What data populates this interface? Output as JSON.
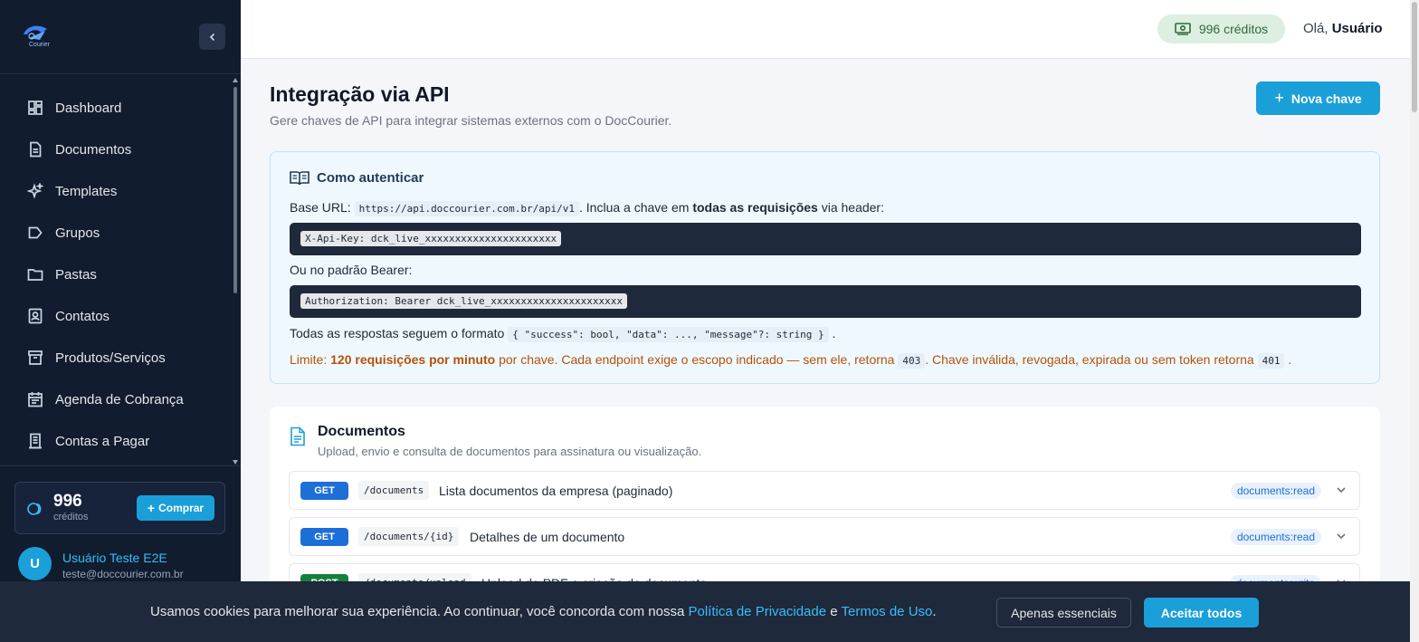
{
  "sidebar": {
    "logo_text": "Courier",
    "items": [
      {
        "label": "Dashboard",
        "icon": "dashboard-icon"
      },
      {
        "label": "Documentos",
        "icon": "document-icon"
      },
      {
        "label": "Templates",
        "icon": "sparkles-icon"
      },
      {
        "label": "Grupos",
        "icon": "tag-icon"
      },
      {
        "label": "Pastas",
        "icon": "folder-icon"
      },
      {
        "label": "Contatos",
        "icon": "contacts-icon"
      },
      {
        "label": "Produtos/Serviços",
        "icon": "archive-icon"
      },
      {
        "label": "Agenda de Cobrança",
        "icon": "calendar-icon"
      },
      {
        "label": "Contas a Pagar",
        "icon": "receipt-icon"
      }
    ],
    "credits": {
      "value": "996",
      "label": "créditos",
      "buy_label": "Comprar"
    },
    "user": {
      "initial": "U",
      "name": "Usuário Teste E2E",
      "email": "teste@doccourier.com.br"
    }
  },
  "header": {
    "credits_label": "996 créditos",
    "greeting_prefix": "Olá,",
    "greeting_name": "Usuário"
  },
  "main": {
    "title": "Integração via API",
    "subtitle": "Gere chaves de API para integrar sistemas externos com o DocCourier.",
    "new_key_label": "Nova chave",
    "auth": {
      "title": "Como autenticar",
      "base_url_label": "Base URL:",
      "base_url": "https://api.doccourier.com.br/api/v1",
      "include_text_1": ". Inclua a chave em",
      "include_bold": "todas as requisições",
      "include_text_2": "via header:",
      "header_example": "X-Api-Key: dck_live_xxxxxxxxxxxxxxxxxxxxxx",
      "bearer_label": "Ou no padrão Bearer:",
      "bearer_example": "Authorization: Bearer dck_live_xxxxxxxxxxxxxxxxxxxxxx",
      "format_text": "Todas as respostas seguem o formato",
      "format_code": "{ \"success\": bool, \"data\": ..., \"message\"?: string }",
      "format_end": ".",
      "limit_prefix": "Limite:",
      "limit_bold": "120 requisições por minuto",
      "limit_text_1": "por chave. Cada endpoint exige o escopo indicado — sem ele, retorna",
      "limit_code_1": "403",
      "limit_text_2": ". Chave inválida, revogada, expirada ou sem token retorna",
      "limit_code_2": "401",
      "limit_end": "."
    },
    "documents": {
      "title": "Documentos",
      "subtitle": "Upload, envio e consulta de documentos para assinatura ou visualização.",
      "endpoints": [
        {
          "method": "GET",
          "path": "/documents",
          "description": "Lista documentos da empresa (paginado)",
          "scope": "documents:read"
        },
        {
          "method": "GET",
          "path": "/documents/{id}",
          "description": "Detalhes de um documento",
          "scope": "documents:read"
        },
        {
          "method": "POST",
          "path": "/documents/upload",
          "description": "Upload de PDF e criação de documento",
          "scope": "documents:write"
        }
      ]
    }
  },
  "cookie": {
    "text": "Usamos cookies para melhorar sua experiência. Ao continuar, você concorda com nossa",
    "privacy_link": "Política de Privacidade",
    "and": "e",
    "terms_link": "Termos de Uso",
    "end": ".",
    "essential_label": "Apenas essenciais",
    "accept_label": "Aceitar todos"
  },
  "colors": {
    "accent": "#1a9fd9",
    "sidebar": "#111c2e",
    "get": "#1d6fd8",
    "post": "#15803d"
  }
}
